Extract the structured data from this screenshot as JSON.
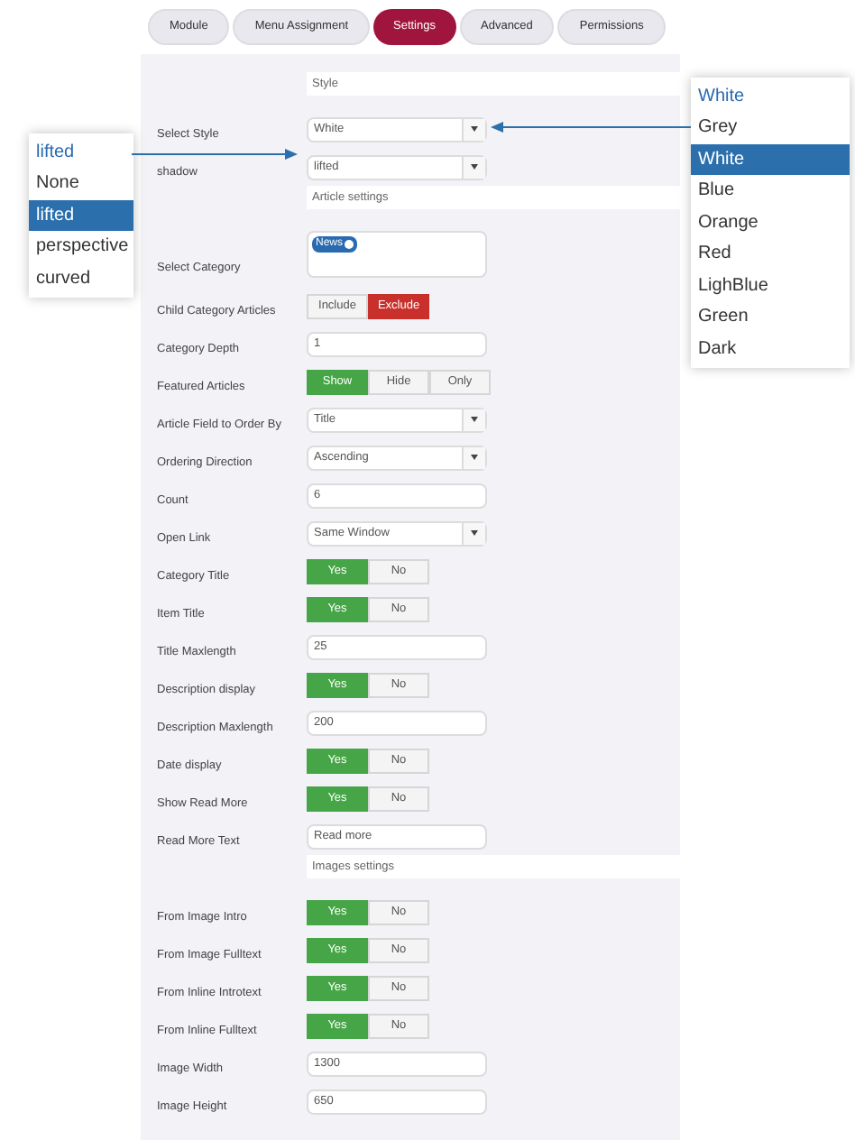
{
  "tabs": [
    {
      "label": "Module",
      "selected": false
    },
    {
      "label": "Menu Assignment",
      "selected": false
    },
    {
      "label": "Settings",
      "selected": true
    },
    {
      "label": "Advanced",
      "selected": false
    },
    {
      "label": "Permissions",
      "selected": false
    }
  ],
  "rows": [
    {
      "kind": "header",
      "text": "Style"
    },
    {
      "kind": "select",
      "label": "Select Style",
      "value": "White"
    },
    {
      "kind": "select",
      "label": "shadow",
      "value": "lifted"
    },
    {
      "kind": "header",
      "text": "Article settings"
    },
    {
      "kind": "tags",
      "label": "Select Category",
      "tags": [
        "News"
      ]
    },
    {
      "kind": "toggle",
      "label": "Child Category Articles",
      "options": [
        {
          "text": "Include",
          "selected": false
        },
        {
          "text": "Exclude",
          "selected": true,
          "color": "#c9302c"
        }
      ]
    },
    {
      "kind": "text",
      "label": "Category Depth",
      "value": "1"
    },
    {
      "kind": "toggle",
      "label": "Featured Articles",
      "options": [
        {
          "text": "Show",
          "selected": true,
          "color": "#46a546"
        },
        {
          "text": "Hide",
          "selected": false
        },
        {
          "text": "Only",
          "selected": false
        }
      ]
    },
    {
      "kind": "select",
      "label": "Article Field to Order By",
      "value": "Title"
    },
    {
      "kind": "select",
      "label": "Ordering Direction",
      "value": "Ascending"
    },
    {
      "kind": "text",
      "label": "Count",
      "value": "6"
    },
    {
      "kind": "select",
      "label": "Open Link",
      "value": "Same Window"
    },
    {
      "kind": "toggle",
      "label": "Category Title",
      "options": [
        {
          "text": "Yes",
          "selected": true,
          "color": "#46a546"
        },
        {
          "text": "No",
          "selected": false
        }
      ]
    },
    {
      "kind": "toggle",
      "label": "Item Title",
      "options": [
        {
          "text": "Yes",
          "selected": true,
          "color": "#46a546"
        },
        {
          "text": "No",
          "selected": false
        }
      ]
    },
    {
      "kind": "text",
      "label": "Title Maxlength",
      "value": "25"
    },
    {
      "kind": "toggle",
      "label": "Description display",
      "options": [
        {
          "text": "Yes",
          "selected": true,
          "color": "#46a546"
        },
        {
          "text": "No",
          "selected": false
        }
      ]
    },
    {
      "kind": "text",
      "label": "Description Maxlength",
      "value": "200"
    },
    {
      "kind": "toggle",
      "label": "Date display",
      "options": [
        {
          "text": "Yes",
          "selected": true,
          "color": "#46a546"
        },
        {
          "text": "No",
          "selected": false
        }
      ]
    },
    {
      "kind": "toggle",
      "label": "Show Read More",
      "options": [
        {
          "text": "Yes",
          "selected": true,
          "color": "#46a546"
        },
        {
          "text": "No",
          "selected": false
        }
      ]
    },
    {
      "kind": "text",
      "label": "Read More Text",
      "value": "Read more"
    },
    {
      "kind": "header",
      "text": "Images settings"
    },
    {
      "kind": "toggle",
      "label": "From Image Intro",
      "options": [
        {
          "text": "Yes",
          "selected": true,
          "color": "#46a546"
        },
        {
          "text": "No",
          "selected": false
        }
      ]
    },
    {
      "kind": "toggle",
      "label": "From Image Fulltext",
      "options": [
        {
          "text": "Yes",
          "selected": true,
          "color": "#46a546"
        },
        {
          "text": "No",
          "selected": false
        }
      ]
    },
    {
      "kind": "toggle",
      "label": "From Inline Introtext",
      "options": [
        {
          "text": "Yes",
          "selected": true,
          "color": "#46a546"
        },
        {
          "text": "No",
          "selected": false
        }
      ]
    },
    {
      "kind": "toggle",
      "label": "From Inline Fulltext",
      "options": [
        {
          "text": "Yes",
          "selected": true,
          "color": "#46a546"
        },
        {
          "text": "No",
          "selected": false
        }
      ]
    },
    {
      "kind": "text",
      "label": "Image Width",
      "value": "1300"
    },
    {
      "kind": "text",
      "label": "Image Height",
      "value": "650"
    }
  ],
  "shadow_popup": {
    "title": "lifted",
    "options": [
      {
        "text": "None",
        "selected": false
      },
      {
        "text": "lifted",
        "selected": true
      },
      {
        "text": "perspective",
        "selected": false
      },
      {
        "text": "curved",
        "selected": false
      }
    ]
  },
  "style_popup": {
    "title": "White",
    "options": [
      {
        "text": "Grey",
        "selected": false
      },
      {
        "text": "White",
        "selected": true
      },
      {
        "text": "Blue",
        "selected": false
      },
      {
        "text": "Orange",
        "selected": false
      },
      {
        "text": "Red",
        "selected": false
      },
      {
        "text": "LighBlue",
        "selected": false
      },
      {
        "text": "Green",
        "selected": false
      },
      {
        "text": "Dark",
        "selected": false
      }
    ]
  }
}
